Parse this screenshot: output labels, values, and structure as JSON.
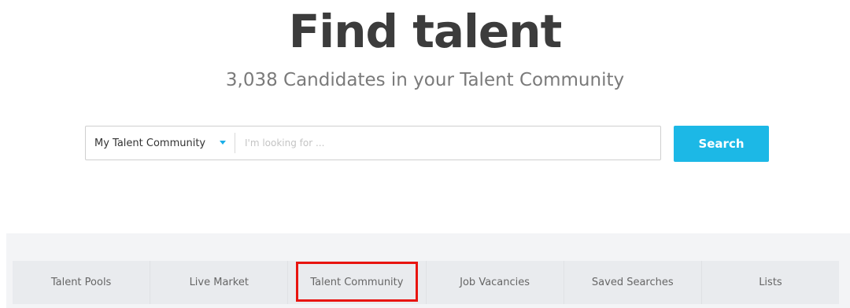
{
  "header": {
    "title": "Find talent",
    "subtitle": "3,038 Candidates in your Talent Community"
  },
  "search": {
    "scope_label": "My Talent Community",
    "placeholder": "I'm looking for ...",
    "value": "",
    "button_label": "Search"
  },
  "tabs": [
    {
      "label": "Talent Pools"
    },
    {
      "label": "Live Market"
    },
    {
      "label": "Talent Community",
      "highlighted": true
    },
    {
      "label": "Job Vacancies"
    },
    {
      "label": "Saved Searches"
    },
    {
      "label": "Lists"
    }
  ],
  "colors": {
    "title": "#3c3c3c",
    "subtitle": "#7a7a7a",
    "accent": "#1cb8e6",
    "caret": "#1aaee8",
    "tab_background": "#e9ebee",
    "tab_text": "#666666",
    "highlight": "#e8140f"
  },
  "icons": {
    "scope_caret": "chevron-down-icon"
  }
}
